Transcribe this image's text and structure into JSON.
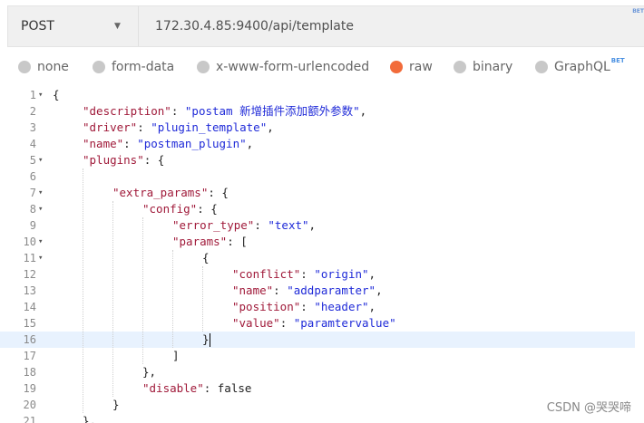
{
  "request": {
    "method": "POST",
    "url": "172.30.4.85:9400/api/template",
    "url_overflow_text": "BET"
  },
  "body_types": [
    {
      "label": "none",
      "selected": false
    },
    {
      "label": "form-data",
      "selected": false
    },
    {
      "label": "x-www-form-urlencoded",
      "selected": false
    },
    {
      "label": "raw",
      "selected": true
    },
    {
      "label": "binary",
      "selected": false
    },
    {
      "label": "GraphQL",
      "selected": false,
      "tag": "BET"
    }
  ],
  "editor": {
    "active_line": 16,
    "lines": [
      {
        "n": "1",
        "fold": true,
        "indent": 0,
        "parts": [
          [
            "p",
            "{"
          ]
        ]
      },
      {
        "n": "2",
        "fold": false,
        "indent": 1,
        "parts": [
          [
            "k",
            "\"description\""
          ],
          [
            "p",
            ": "
          ],
          [
            "s",
            "\"postam 新增插件添加额外参数\""
          ],
          [
            "p",
            ","
          ]
        ]
      },
      {
        "n": "3",
        "fold": false,
        "indent": 1,
        "parts": [
          [
            "k",
            "\"driver\""
          ],
          [
            "p",
            ": "
          ],
          [
            "s",
            "\"plugin_template\""
          ],
          [
            "p",
            ","
          ]
        ]
      },
      {
        "n": "4",
        "fold": false,
        "indent": 1,
        "parts": [
          [
            "k",
            "\"name\""
          ],
          [
            "p",
            ": "
          ],
          [
            "s",
            "\"postman_plugin\""
          ],
          [
            "p",
            ","
          ]
        ]
      },
      {
        "n": "5",
        "fold": true,
        "indent": 1,
        "parts": [
          [
            "k",
            "\"plugins\""
          ],
          [
            "p",
            ": {"
          ]
        ]
      },
      {
        "n": "6",
        "fold": false,
        "indent": 0,
        "parts": []
      },
      {
        "n": "7",
        "fold": true,
        "indent": 2,
        "parts": [
          [
            "k",
            "\"extra_params\""
          ],
          [
            "p",
            ": {"
          ]
        ]
      },
      {
        "n": "8",
        "fold": true,
        "indent": 3,
        "parts": [
          [
            "k",
            "\"config\""
          ],
          [
            "p",
            ": {"
          ]
        ]
      },
      {
        "n": "9",
        "fold": false,
        "indent": 4,
        "parts": [
          [
            "k",
            "\"error_type\""
          ],
          [
            "p",
            ": "
          ],
          [
            "s",
            "\"text\""
          ],
          [
            "p",
            ","
          ]
        ]
      },
      {
        "n": "10",
        "fold": true,
        "indent": 4,
        "parts": [
          [
            "k",
            "\"params\""
          ],
          [
            "p",
            ": ["
          ]
        ]
      },
      {
        "n": "11",
        "fold": true,
        "indent": 5,
        "parts": [
          [
            "p",
            "{"
          ]
        ]
      },
      {
        "n": "12",
        "fold": false,
        "indent": 6,
        "parts": [
          [
            "k",
            "\"conflict\""
          ],
          [
            "p",
            ": "
          ],
          [
            "s",
            "\"origin\""
          ],
          [
            "p",
            ","
          ]
        ]
      },
      {
        "n": "13",
        "fold": false,
        "indent": 6,
        "parts": [
          [
            "k",
            "\"name\""
          ],
          [
            "p",
            ": "
          ],
          [
            "s",
            "\"addparamter\""
          ],
          [
            "p",
            ","
          ]
        ]
      },
      {
        "n": "14",
        "fold": false,
        "indent": 6,
        "parts": [
          [
            "k",
            "\"position\""
          ],
          [
            "p",
            ": "
          ],
          [
            "s",
            "\"header\""
          ],
          [
            "p",
            ","
          ]
        ]
      },
      {
        "n": "15",
        "fold": false,
        "indent": 6,
        "parts": [
          [
            "k",
            "\"value\""
          ],
          [
            "p",
            ": "
          ],
          [
            "s",
            "\"paramtervalue\""
          ]
        ]
      },
      {
        "n": "16",
        "fold": false,
        "indent": 5,
        "parts": [
          [
            "p",
            "}"
          ]
        ]
      },
      {
        "n": "17",
        "fold": false,
        "indent": 4,
        "parts": [
          [
            "p",
            "]"
          ]
        ]
      },
      {
        "n": "18",
        "fold": false,
        "indent": 3,
        "parts": [
          [
            "p",
            "},"
          ]
        ]
      },
      {
        "n": "19",
        "fold": false,
        "indent": 3,
        "parts": [
          [
            "k",
            "\"disable\""
          ],
          [
            "p",
            ": false"
          ]
        ]
      },
      {
        "n": "20",
        "fold": false,
        "indent": 2,
        "parts": [
          [
            "p",
            "}"
          ]
        ]
      },
      {
        "n": "21",
        "fold": false,
        "indent": 1,
        "parts": [
          [
            "p",
            "},"
          ]
        ]
      }
    ]
  },
  "watermark": "CSDN @哭哭啼"
}
